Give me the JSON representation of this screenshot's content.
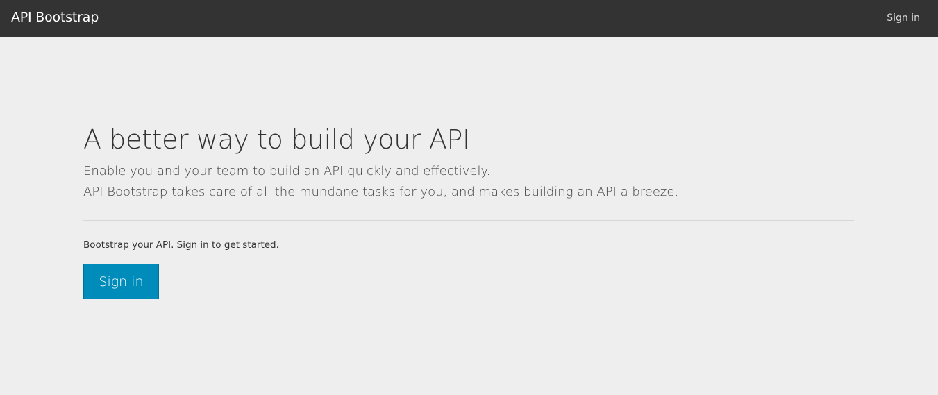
{
  "navbar": {
    "brand": "API Bootstrap",
    "signin_label": "Sign in"
  },
  "hero": {
    "title": "A better way to build your API",
    "line1": "Enable you and your team to build an API quickly and effectively.",
    "line2": "API Bootstrap takes care of all the mundane tasks for you, and makes building an API a breeze."
  },
  "cta": {
    "prompt": "Bootstrap your API. Sign in to get started.",
    "button_label": "Sign in"
  },
  "colors": {
    "navbar_bg": "#333333",
    "page_bg": "#eeeeee",
    "primary_button": "#008cba"
  }
}
